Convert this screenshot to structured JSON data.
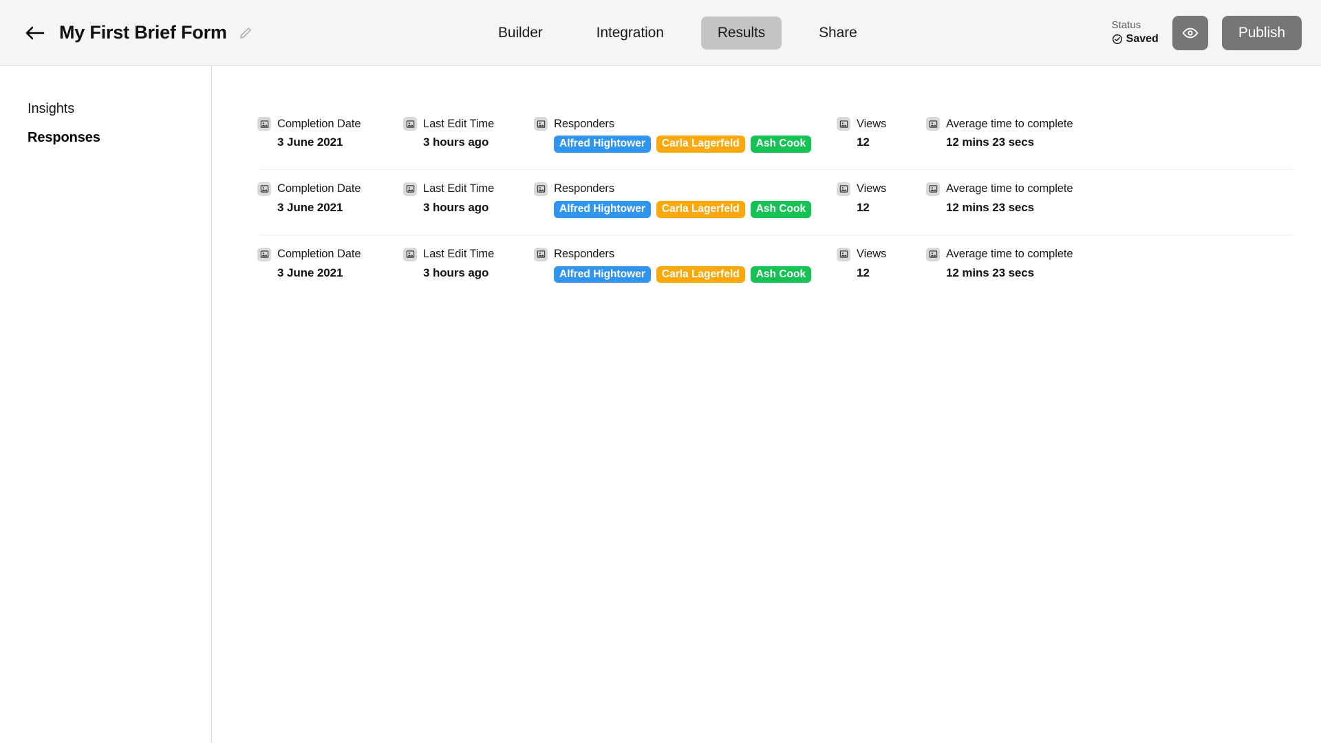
{
  "header": {
    "back_icon": "arrow-left-icon",
    "title": "My First Brief Form",
    "edit_icon": "pencil-icon",
    "tabs": [
      {
        "label": "Builder",
        "active": false
      },
      {
        "label": "Integration",
        "active": false
      },
      {
        "label": "Results",
        "active": true
      },
      {
        "label": "Share",
        "active": false
      }
    ],
    "status": {
      "label": "Status",
      "value": "Saved",
      "icon": "check-circle-icon"
    },
    "preview_icon": "eye-icon",
    "publish_label": "Publish",
    "colors": {
      "header_bg": "#f5f5f5",
      "active_tab_bg": "#c4c4c4",
      "button_bg": "#767676"
    }
  },
  "sidebar": {
    "items": [
      {
        "label": "Insights",
        "active": false
      },
      {
        "label": "Responses",
        "active": true
      }
    ]
  },
  "main": {
    "columns": [
      {
        "key": "completion_date",
        "label": "Completion Date",
        "icon": "image-field-icon"
      },
      {
        "key": "last_edit_time",
        "label": "Last Edit Time",
        "icon": "image-field-icon"
      },
      {
        "key": "responders",
        "label": "Responders",
        "icon": "image-field-icon"
      },
      {
        "key": "views",
        "label": "Views",
        "icon": "image-field-icon"
      },
      {
        "key": "average_time",
        "label": "Average time to complete",
        "icon": "image-field-icon"
      }
    ],
    "rows": [
      {
        "completion_date": "3 June 2021",
        "last_edit_time": "3 hours ago",
        "responders": [
          {
            "name": "Alfred Hightower",
            "color": "#2f95f0"
          },
          {
            "name": "Carla Lagerfeld",
            "color": "#fba90a"
          },
          {
            "name": "Ash Cook",
            "color": "#15c254"
          }
        ],
        "views": "12",
        "average_time": "12 mins 23 secs"
      },
      {
        "completion_date": "3 June 2021",
        "last_edit_time": "3 hours ago",
        "responders": [
          {
            "name": "Alfred Hightower",
            "color": "#2f95f0"
          },
          {
            "name": "Carla Lagerfeld",
            "color": "#fba90a"
          },
          {
            "name": "Ash Cook",
            "color": "#15c254"
          }
        ],
        "views": "12",
        "average_time": "12 mins 23 secs"
      },
      {
        "completion_date": "3 June 2021",
        "last_edit_time": "3 hours ago",
        "responders": [
          {
            "name": "Alfred Hightower",
            "color": "#2f95f0"
          },
          {
            "name": "Carla Lagerfeld",
            "color": "#fba90a"
          },
          {
            "name": "Ash Cook",
            "color": "#15c254"
          }
        ],
        "views": "12",
        "average_time": "12 mins 23 secs"
      }
    ]
  }
}
